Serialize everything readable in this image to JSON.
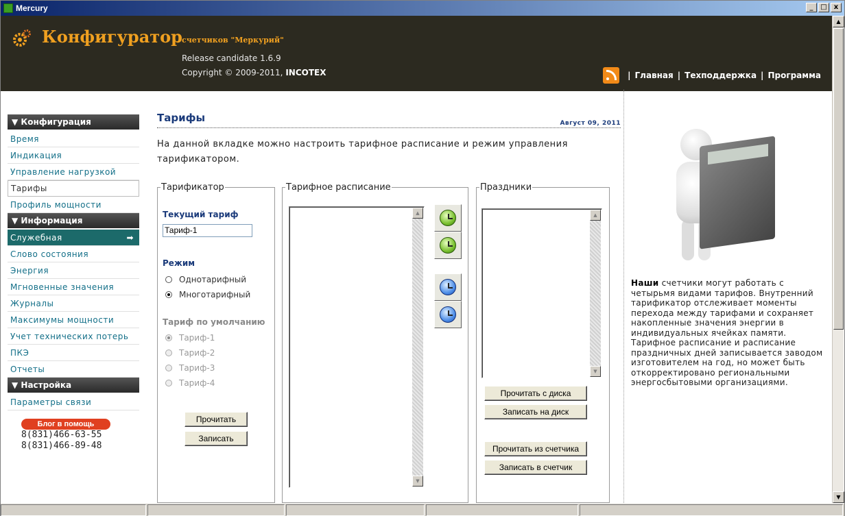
{
  "window": {
    "title": "Mercury",
    "minimize": "_",
    "maximize": "□",
    "close": "x"
  },
  "header": {
    "title": "Конфигуратор",
    "subtitle": "счетчиков \"Меркурий\"",
    "release": "Release candidate 1.6.9",
    "copyright_prefix": "Copyright © 2009-2011, ",
    "copyright_company": "INCOTEX",
    "nav": [
      "Главная",
      "Техподдержка",
      "Программа"
    ],
    "nav_sep": "|"
  },
  "sidebar": {
    "sections": [
      {
        "title": "▼ Конфигурация",
        "items": [
          "Время",
          "Индикация",
          "Управление нагрузкой",
          "Тарифы",
          "Профиль мощности"
        ]
      },
      {
        "title": "▼ Информация",
        "items": [
          "Служебная",
          "Слово состояния",
          "Энергия",
          "Мгновенные значения",
          "Журналы",
          "Максимумы мощности",
          "Учет технических потерь",
          "ПКЭ",
          "Отчеты"
        ]
      },
      {
        "title": "▼ Настройка",
        "items": [
          "Параметры связи"
        ]
      }
    ],
    "active_item": "Тарифы",
    "selected_item": "Служебная",
    "selected_arrow": "➡",
    "blog_button": "Блог в помощь",
    "phones": [
      "8(831)466-63-55",
      "8(831)466-89-48"
    ]
  },
  "main": {
    "title": "Тарифы",
    "date": "Август 09, 2011",
    "intro": "На данной вкладке можно настроить тарифное расписание и режим управления тарификатором.",
    "tarif_group": {
      "legend": "Тарификатор",
      "current_label": "Текущий тариф",
      "current_value": "Тариф-1",
      "mode_label": "Режим",
      "modes": [
        "Однотарифный",
        "Многотарифный"
      ],
      "mode_selected": "Многотарифный",
      "default_label": "Тариф по умолчанию",
      "defaults": [
        "Тариф-1",
        "Тариф-2",
        "Тариф-3",
        "Тариф-4"
      ],
      "default_selected": "Тариф-1",
      "read_button": "Прочитать",
      "write_button": "Записать"
    },
    "schedule_group": {
      "legend": "Тарифное расписание",
      "icons": [
        "clock-add-icon",
        "clock-refresh-icon",
        "clock-blue-icon",
        "clock-blue-refresh-icon"
      ]
    },
    "holidays_group": {
      "legend": "Праздники",
      "read_disk": "Прочитать с диска",
      "write_disk": "Записать на диск",
      "read_meter": "Прочитать из счетчика",
      "write_meter": "Записать в счетчик"
    }
  },
  "right": {
    "desc_bold": "Наши",
    "desc_rest": " счетчики могут работать с четырьмя видами тарифов. Внутренний тарификатор отслеживает моменты перехода между тарифами и сохраняет накопленные значения энергии в индивидуальных ячейках памяти. Тарифное расписание и расписание праздничных дней записывается заводом изготовителем на год, но может быть откорректировано региональными энергосбытовыми организациями."
  },
  "colors": {
    "header_bg": "#2c2a20",
    "accent_orange": "#f0a020",
    "link_teal": "#136f88",
    "selected_bg": "#1c6a6a",
    "title_blue": "#1a3a7a"
  }
}
